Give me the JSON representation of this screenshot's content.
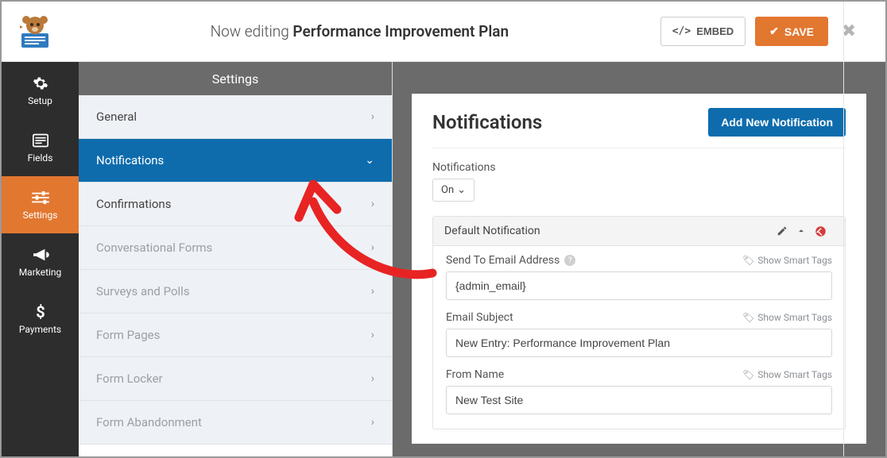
{
  "header": {
    "editing_prefix": "Now editing",
    "editing_title": "Performance Improvement Plan",
    "embed_label": "EMBED",
    "save_label": "SAVE"
  },
  "sidenav": {
    "items": [
      {
        "key": "setup",
        "label": "Setup",
        "icon": "gear"
      },
      {
        "key": "fields",
        "label": "Fields",
        "icon": "list"
      },
      {
        "key": "settings",
        "label": "Settings",
        "icon": "sliders",
        "active": true
      },
      {
        "key": "marketing",
        "label": "Marketing",
        "icon": "bullhorn"
      },
      {
        "key": "payments",
        "label": "Payments",
        "icon": "dollar"
      }
    ]
  },
  "subnav": {
    "title": "Settings",
    "items": [
      {
        "label": "General"
      },
      {
        "label": "Notifications",
        "selected": true,
        "expanded": true
      },
      {
        "label": "Confirmations"
      },
      {
        "label": "Conversational Forms",
        "muted": true
      },
      {
        "label": "Surveys and Polls",
        "muted": true
      },
      {
        "label": "Form Pages",
        "muted": true
      },
      {
        "label": "Form Locker",
        "muted": true
      },
      {
        "label": "Form Abandonment",
        "muted": true
      }
    ]
  },
  "panel": {
    "heading": "Notifications",
    "add_button": "Add New Notification",
    "toggle_label": "Notifications",
    "toggle_value": "On",
    "smart_tags_label": "Show Smart Tags",
    "notification": {
      "title": "Default Notification",
      "fields": [
        {
          "label": "Send To Email Address",
          "value": "{admin_email}",
          "help": true
        },
        {
          "label": "Email Subject",
          "value": "New Entry: Performance Improvement Plan"
        },
        {
          "label": "From Name",
          "value": "New Test Site"
        }
      ]
    }
  }
}
